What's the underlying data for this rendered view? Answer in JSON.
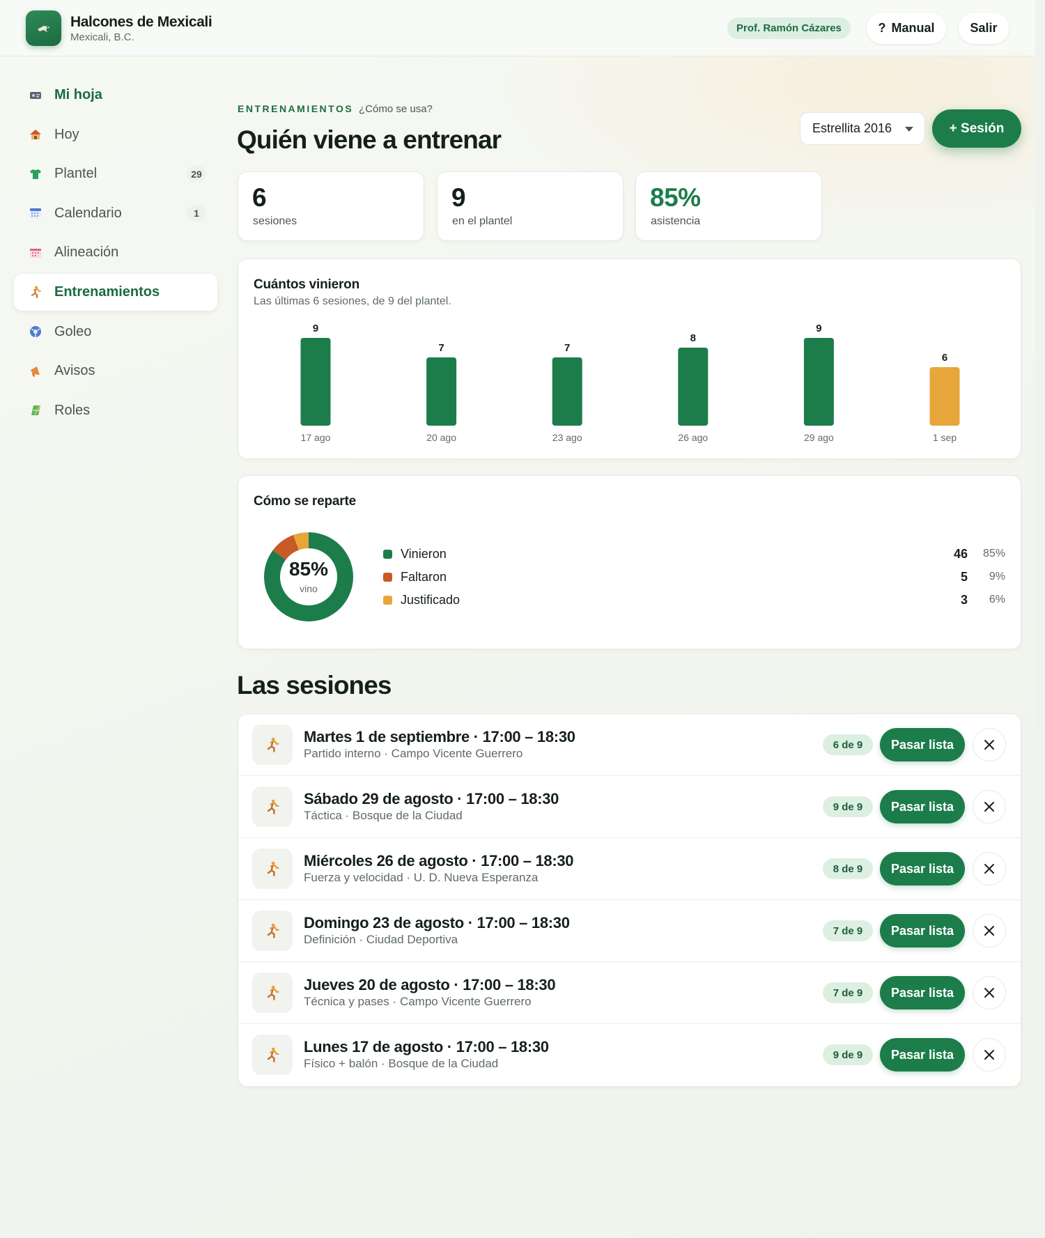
{
  "app": {
    "name": "Halcones de Mexicali",
    "place": "Mexicali, B.C.",
    "user": "Prof. Ramón Cázares",
    "manual_label": "Manual",
    "manual_glyph": "?",
    "logout_label": "Salir"
  },
  "sidebar": {
    "items": [
      {
        "label": "Mi hoja",
        "icon": "id-card-icon",
        "badge": ""
      },
      {
        "label": "Hoy",
        "icon": "house-icon",
        "badge": ""
      },
      {
        "label": "Plantel",
        "icon": "jersey-icon",
        "badge": "29"
      },
      {
        "label": "Calendario",
        "icon": "calendar-icon",
        "badge": "1"
      },
      {
        "label": "Alineación",
        "icon": "lineup-board-icon",
        "badge": ""
      },
      {
        "label": "Entrenamientos",
        "icon": "runner-icon",
        "badge": ""
      },
      {
        "label": "Goleo",
        "icon": "soccer-ball-icon",
        "badge": ""
      },
      {
        "label": "Avisos",
        "icon": "megaphone-icon",
        "badge": ""
      },
      {
        "label": "Roles",
        "icon": "field-icon",
        "badge": ""
      }
    ]
  },
  "header": {
    "kicker": "ENTRENAMIENTOS",
    "help_link": "¿Cómo se usa?",
    "title": "Quién viene a entrenar",
    "team_selected": "Estrellita 2016",
    "new_session_label": "+ Sesión"
  },
  "stats": [
    {
      "value": "6",
      "label": "sesiones"
    },
    {
      "value": "9",
      "label": "en el plantel"
    },
    {
      "value": "85%",
      "label": "asistencia"
    }
  ],
  "attendance_card": {
    "title": "Cuántos vinieron",
    "subtitle": "Las últimas 6 sesiones, de 9 del plantel."
  },
  "distribution_card": {
    "title": "Cómo se reparte",
    "center_value": "85%",
    "center_label": "vino"
  },
  "chart_data": [
    {
      "type": "bar",
      "title": "Cuántos vinieron",
      "subtitle": "Las últimas 6 sesiones, de 9 del plantel.",
      "categories": [
        "17 ago",
        "20 ago",
        "23 ago",
        "26 ago",
        "29 ago",
        "1 sep"
      ],
      "values": [
        9,
        7,
        7,
        8,
        9,
        6
      ],
      "value_labels": [
        "9",
        "7",
        "7",
        "8",
        "9",
        "6"
      ],
      "ylim": [
        0,
        9
      ],
      "grid": false,
      "colors": [
        "#1c7d4b",
        "#1c7d4b",
        "#1c7d4b",
        "#1c7d4b",
        "#1c7d4b",
        "#e6a63a"
      ]
    },
    {
      "type": "pie",
      "title": "Cómo se reparte",
      "donut": true,
      "slices": [
        {
          "name": "Vinieron",
          "count": "46",
          "pct": "85%",
          "value": 46,
          "color": "#1c7d4b"
        },
        {
          "name": "Faltaron",
          "count": "5",
          "pct": "9%",
          "value": 5,
          "color": "#c85a28"
        },
        {
          "name": "Justificado",
          "count": "3",
          "pct": "6%",
          "value": 3,
          "color": "#e6a63a"
        }
      ],
      "legend_position": "right"
    }
  ],
  "sessions_section": {
    "title": "Las sesiones"
  },
  "sessions": [
    {
      "title": "Martes 1 de septiembre · 17:00 – 18:30",
      "subtitle": "Partido interno · Campo Vicente Guerrero",
      "count": "6 de 9",
      "action": "Pasar lista"
    },
    {
      "title": "Sábado 29 de agosto · 17:00 – 18:30",
      "subtitle": "Táctica · Bosque de la Ciudad",
      "count": "9 de 9",
      "action": "Pasar lista"
    },
    {
      "title": "Miércoles 26 de agosto · 17:00 – 18:30",
      "subtitle": "Fuerza y velocidad · U. D. Nueva Esperanza",
      "count": "8 de 9",
      "action": "Pasar lista"
    },
    {
      "title": "Domingo 23 de agosto · 17:00 – 18:30",
      "subtitle": "Definición · Ciudad Deportiva",
      "count": "7 de 9",
      "action": "Pasar lista"
    },
    {
      "title": "Jueves 20 de agosto · 17:00 – 18:30",
      "subtitle": "Técnica y pases · Campo Vicente Guerrero",
      "count": "7 de 9",
      "action": "Pasar lista"
    },
    {
      "title": "Lunes 17 de agosto · 17:00 – 18:30",
      "subtitle": "Físico + balón · Bosque de la Ciudad",
      "count": "9 de 9",
      "action": "Pasar lista"
    }
  ],
  "colors": {
    "accent": "#1c7d4b",
    "warning": "#e6a63a",
    "danger": "#c85a28",
    "pill_bg": "#dcefe1"
  }
}
